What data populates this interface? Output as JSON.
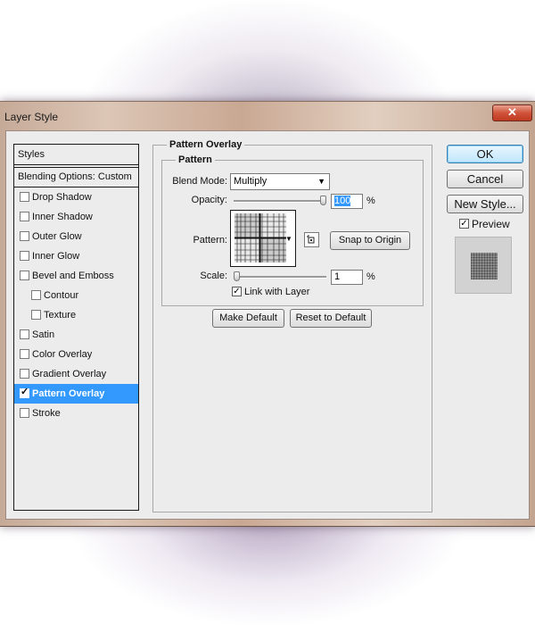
{
  "window": {
    "title": "Layer Style",
    "close_glyph": "✕"
  },
  "sidebar": {
    "header": "Styles",
    "blending": "Blending Options: Custom",
    "items": [
      {
        "label": "Drop Shadow",
        "checked": false,
        "indent": false
      },
      {
        "label": "Inner Shadow",
        "checked": false,
        "indent": false
      },
      {
        "label": "Outer Glow",
        "checked": false,
        "indent": false
      },
      {
        "label": "Inner Glow",
        "checked": false,
        "indent": false
      },
      {
        "label": "Bevel and Emboss",
        "checked": false,
        "indent": false
      },
      {
        "label": "Contour",
        "checked": false,
        "indent": true
      },
      {
        "label": "Texture",
        "checked": false,
        "indent": true
      },
      {
        "label": "Satin",
        "checked": false,
        "indent": false
      },
      {
        "label": "Color Overlay",
        "checked": false,
        "indent": false
      },
      {
        "label": "Gradient Overlay",
        "checked": false,
        "indent": false
      },
      {
        "label": "Pattern Overlay",
        "checked": true,
        "indent": false,
        "active": true
      },
      {
        "label": "Stroke",
        "checked": false,
        "indent": false
      }
    ],
    "active_color": "#3399ff"
  },
  "panel": {
    "group_title": "Pattern Overlay",
    "subgroup_title": "Pattern",
    "blend_mode_label": "Blend Mode:",
    "blend_mode_value": "Multiply",
    "opacity_label": "Opacity:",
    "opacity_value": "100",
    "opacity_unit": "%",
    "opacity_fraction": 1.0,
    "pattern_label": "Pattern:",
    "snap_button": "Snap to Origin",
    "scale_label": "Scale:",
    "scale_value": "1",
    "scale_unit": "%",
    "scale_fraction": 0.0,
    "link_label": "Link with Layer",
    "link_checked": true,
    "make_default": "Make Default",
    "reset_default": "Reset to Default"
  },
  "actions": {
    "ok": "OK",
    "cancel": "Cancel",
    "new_style": "New Style...",
    "preview_label": "Preview",
    "preview_checked": true
  }
}
